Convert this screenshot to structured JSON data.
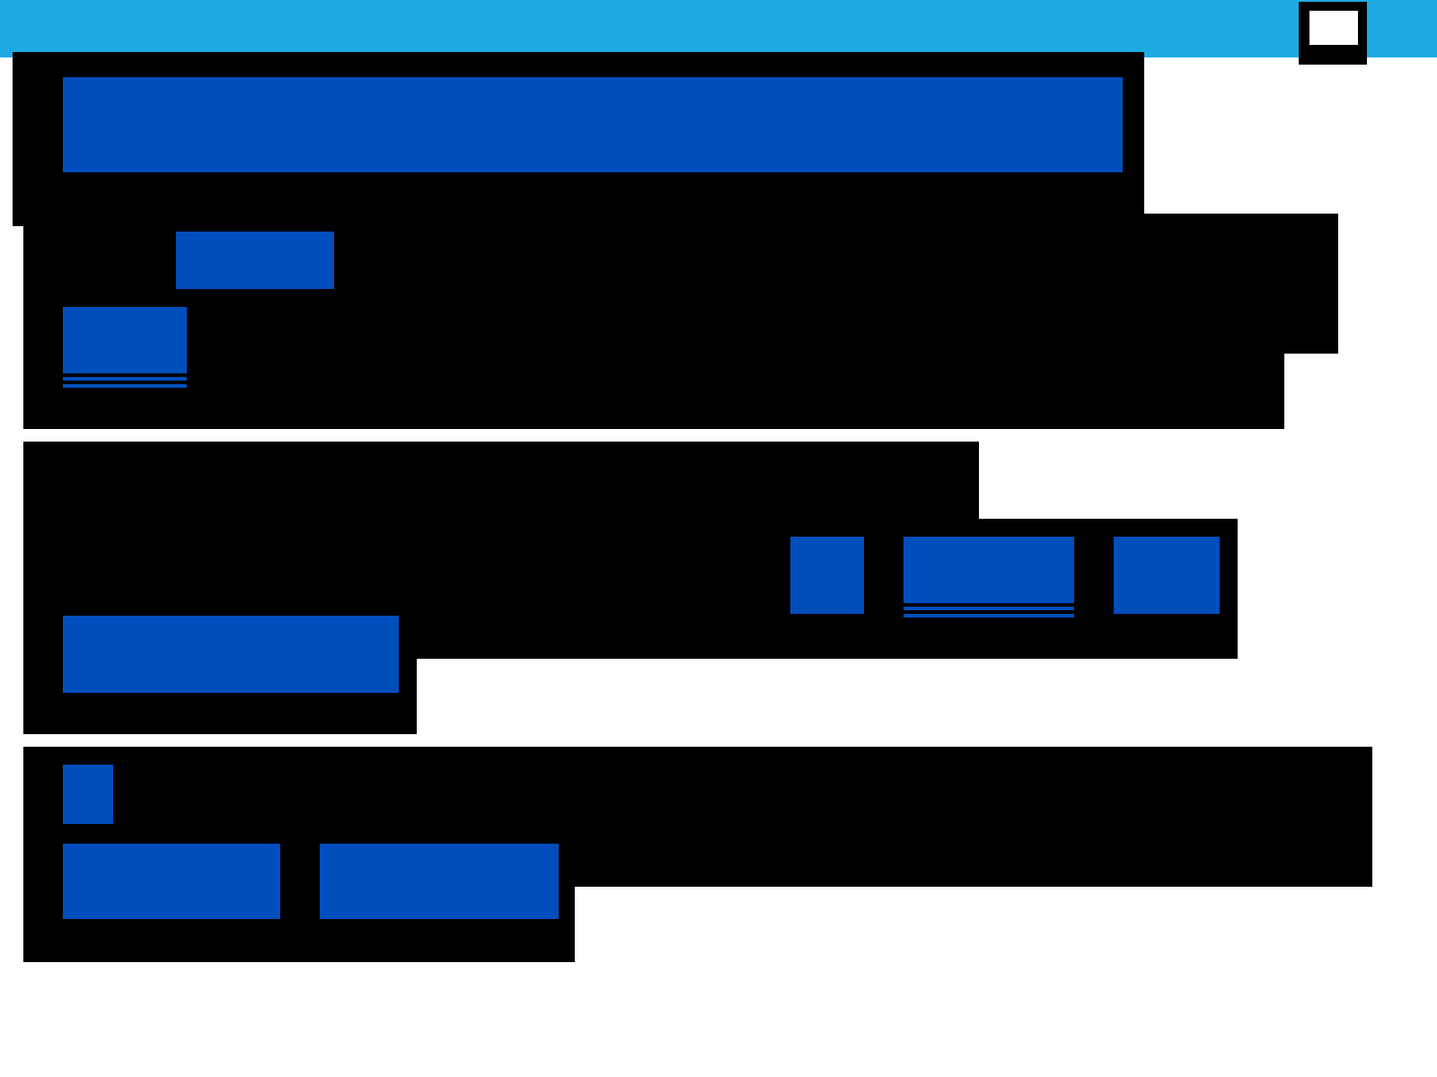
{
  "header": {
    "kind": "bar",
    "icon": {
      "kind": "square"
    }
  },
  "sections": [
    {
      "items": [
        {
          "kind": "bar"
        }
      ]
    },
    {
      "items": [
        {
          "kind": "bar"
        },
        {
          "kind": "link"
        }
      ]
    },
    {
      "items": [
        {
          "kind": "bar"
        },
        {
          "kind": "link"
        },
        {
          "kind": "bar"
        },
        {
          "kind": "bar"
        }
      ]
    },
    {
      "items": [
        {
          "kind": "bar"
        },
        {
          "kind": "bar"
        },
        {
          "kind": "bar"
        }
      ]
    }
  ]
}
